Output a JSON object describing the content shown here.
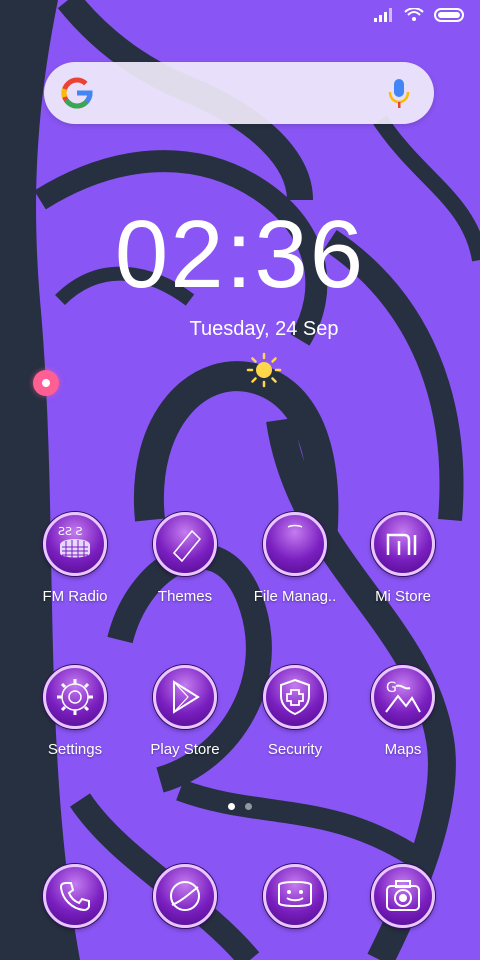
{
  "status_bar": {
    "icons": [
      "signal-icon",
      "wifi-icon",
      "battery-icon"
    ]
  },
  "search": {
    "logo": "google-logo",
    "mic": "mic-icon"
  },
  "clock": {
    "time": "02:36",
    "date": "Tuesday, 24 Sep",
    "weather_icon": "sun-icon"
  },
  "apps_row1": [
    {
      "label": "FM Radio",
      "icon": "radio-icon"
    },
    {
      "label": "Themes",
      "icon": "themes-icon"
    },
    {
      "label": "File Manag..",
      "icon": "file-manager-icon"
    },
    {
      "label": "Mi Store",
      "icon": "mi-store-icon"
    }
  ],
  "apps_row2": [
    {
      "label": "Settings",
      "icon": "gear-icon"
    },
    {
      "label": "Play Store",
      "icon": "play-store-icon"
    },
    {
      "label": "Security",
      "icon": "shield-plus-icon"
    },
    {
      "label": "Maps",
      "icon": "map-icon"
    }
  ],
  "dock": [
    {
      "icon": "phone-icon"
    },
    {
      "icon": "browser-icon"
    },
    {
      "icon": "messages-icon"
    },
    {
      "icon": "camera-icon"
    }
  ],
  "pager": {
    "pages": 2,
    "active": 1
  },
  "colors": {
    "wallpaper": "#8a55f5",
    "swirl": "#263040",
    "accent": "#7a1fc0"
  }
}
